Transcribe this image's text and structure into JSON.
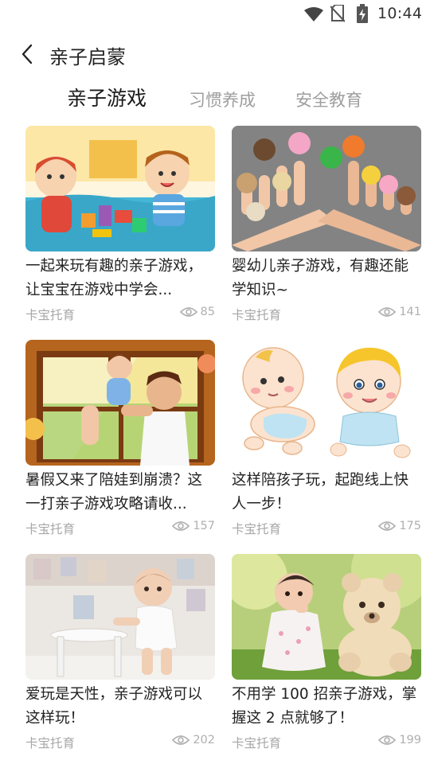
{
  "status_bar": {
    "time": "10:44",
    "icons": [
      "wifi-icon",
      "no-sim-icon",
      "battery-charging-icon"
    ]
  },
  "header": {
    "back_icon": "chevron-left-icon",
    "title": "亲子启蒙"
  },
  "tabs": [
    {
      "label": "亲子游戏",
      "active": true
    },
    {
      "label": "习惯养成",
      "active": false
    },
    {
      "label": "安全教育",
      "active": false
    }
  ],
  "cards": [
    {
      "title": "一起来玩有趣的亲子游戏，让宝宝在游戏中学会...",
      "source": "卡宝托育",
      "views": "85",
      "image": "cartoon kids playing with blocks"
    },
    {
      "title": "婴幼儿亲子游戏，有趣还能学知识~",
      "source": "卡宝托育",
      "views": "141",
      "image": "finger puppets on hands"
    },
    {
      "title": "暑假又来了陪娃到崩溃？这一打亲子游戏攻略请收...",
      "source": "卡宝托育",
      "views": "157",
      "image": "father lifting baby illustration"
    },
    {
      "title": "这样陪孩子玩，起跑线上快人一步！",
      "source": "卡宝托育",
      "views": "175",
      "image": "two cartoon babies crawling"
    },
    {
      "title": "爱玩是天性，亲子游戏可以这样玩！",
      "source": "卡宝托育",
      "views": "202",
      "image": "baby standing at stool"
    },
    {
      "title": "不用学 100 招亲子游戏，掌握这 2 点就够了！",
      "source": "卡宝托育",
      "views": "199",
      "image": "baby with teddy bear"
    }
  ],
  "colors": {
    "active_tab": "#1a1a1a",
    "inactive_tab": "#9e9e9e",
    "meta_text": "#a7a7a7"
  }
}
